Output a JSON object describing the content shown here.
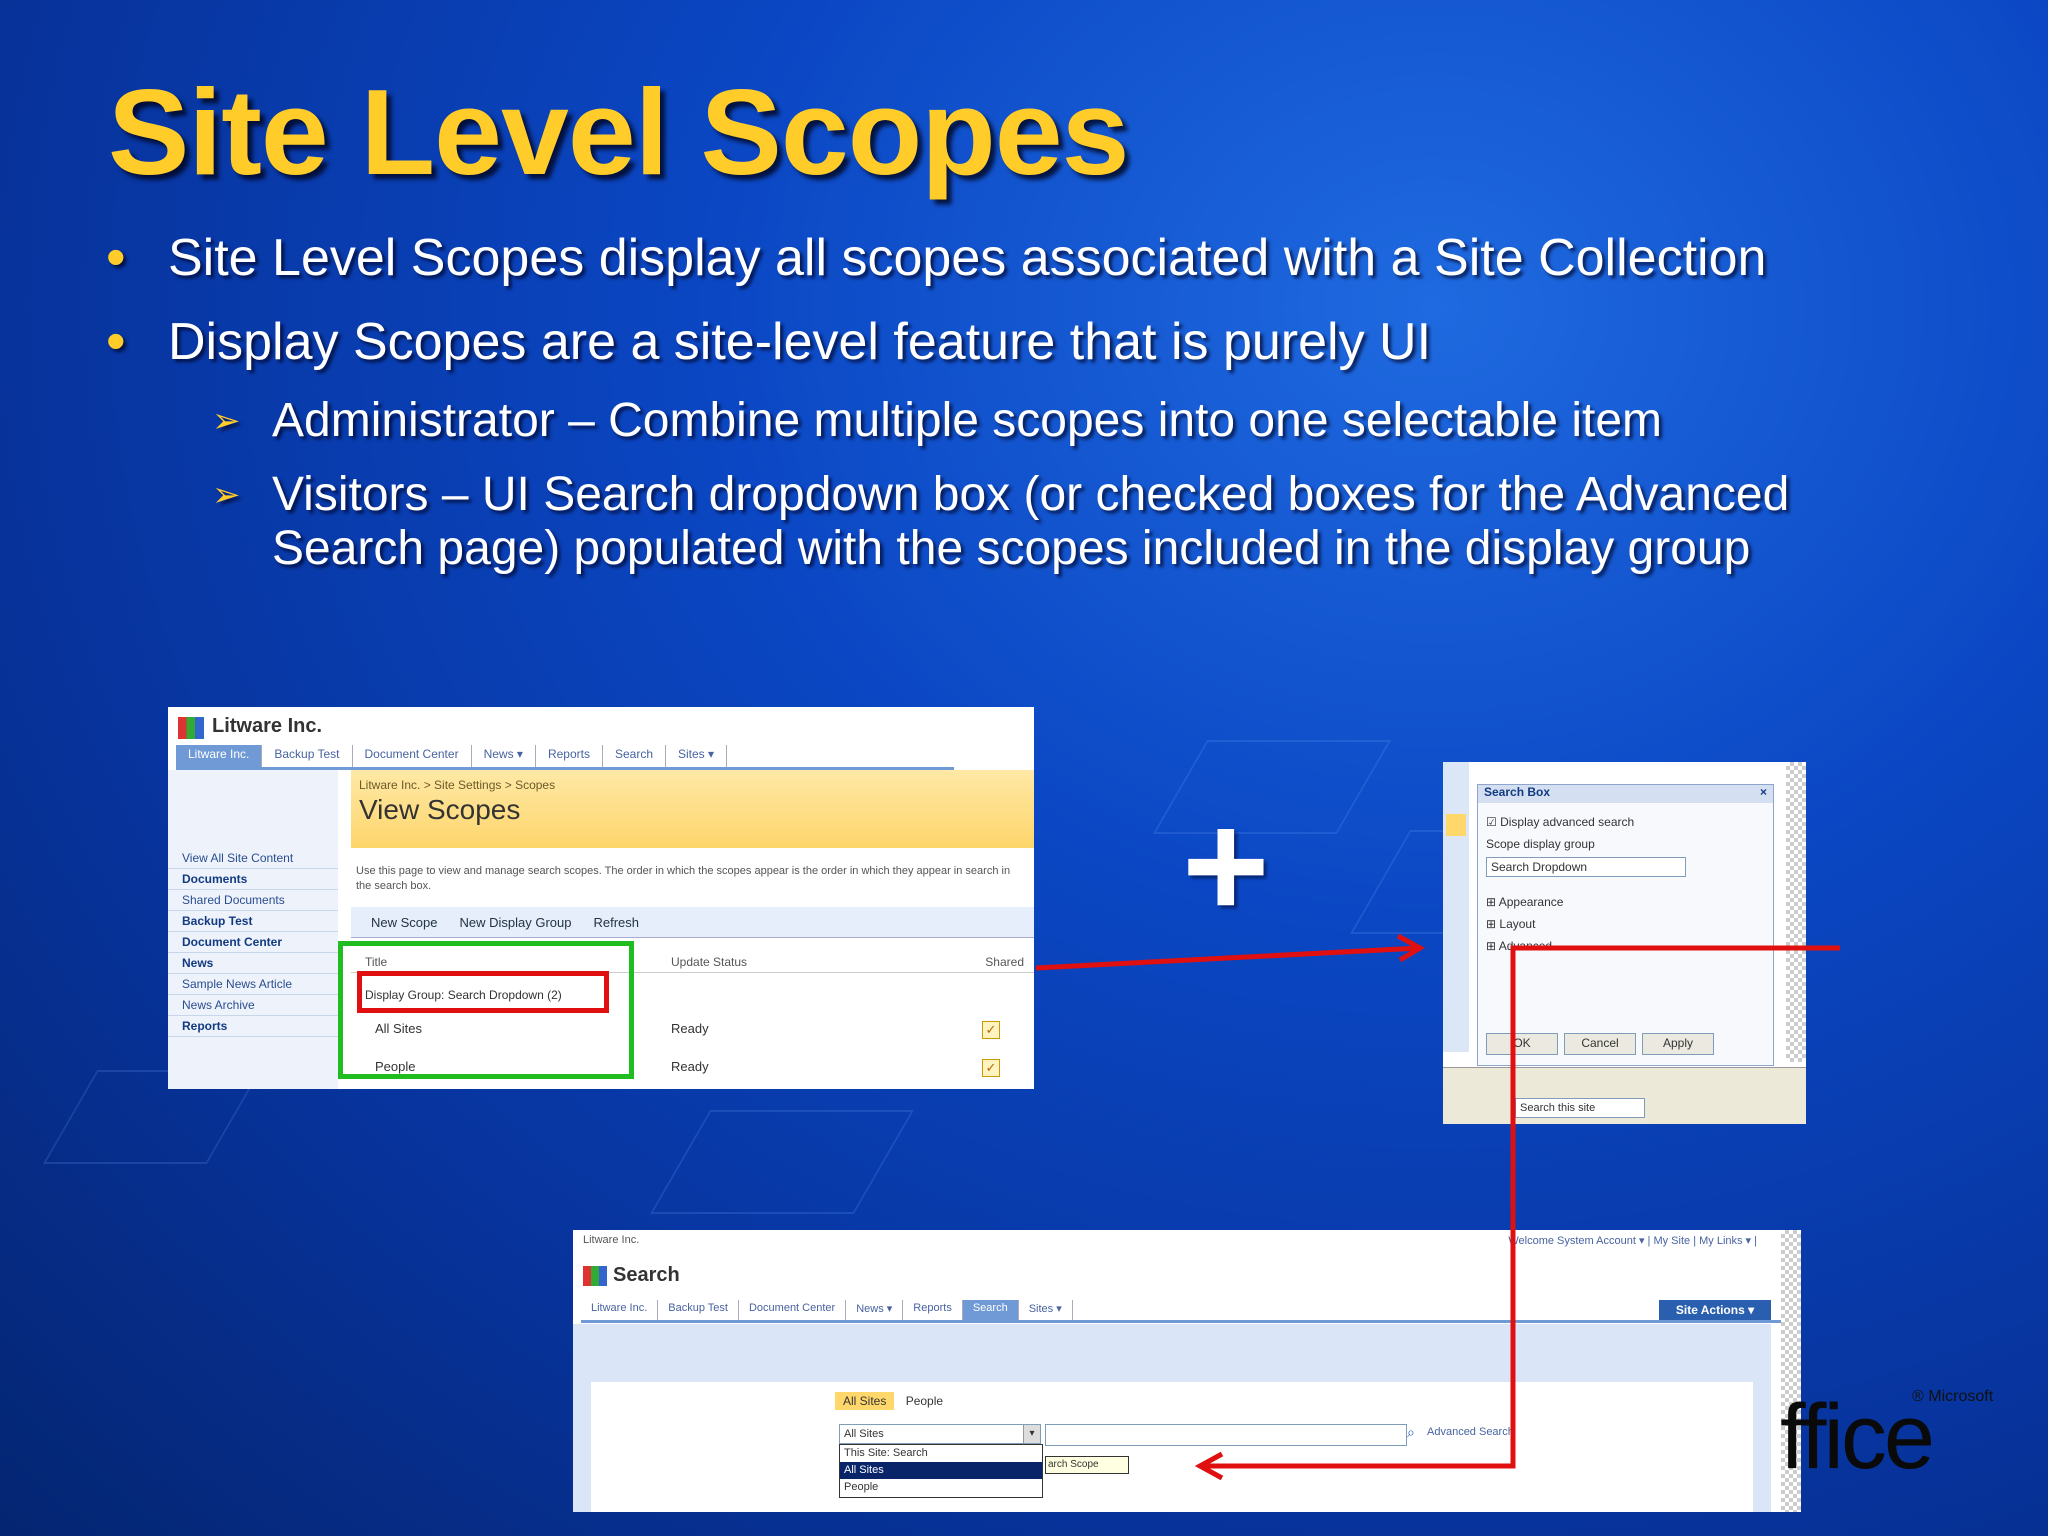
{
  "slide": {
    "title": "Site Level Scopes",
    "bullets": [
      "Site Level Scopes display all scopes associated with a Site Collection",
      "Display Scopes are a site-level feature that is purely UI"
    ],
    "sub_bullets": [
      "Administrator – Combine multiple scopes into one selectable item",
      "Visitors – UI Search dropdown box (or checked boxes for the Advanced Search page) populated with the scopes included in the display group"
    ],
    "plus": "+"
  },
  "scopes_screenshot": {
    "brand": "Litware Inc.",
    "tabs": [
      "Litware Inc.",
      "Backup Test",
      "Document Center",
      "News ▾",
      "Reports",
      "Search",
      "Sites ▾"
    ],
    "breadcrumb": "Litware Inc. > Site Settings > Scopes",
    "page_title": "View Scopes",
    "description": "Use this page to view and manage search scopes. The order in which the scopes appear is the order in which they appear in search in the search box.",
    "left_nav": [
      "View All Site Content",
      "Documents",
      "Shared Documents",
      "Backup Test",
      "Document Center",
      "News",
      "Sample News Article",
      "News Archive",
      "Reports"
    ],
    "toolbar": [
      "New Scope",
      "New Display Group",
      "Refresh"
    ],
    "columns": [
      "Title",
      "Update Status",
      "Shared"
    ],
    "group_row": "Display Group: Search Dropdown (2)",
    "rows": [
      {
        "title": "All Sites",
        "status": "Ready",
        "shared": "✓"
      },
      {
        "title": "People",
        "status": "Ready",
        "shared": "✓"
      }
    ]
  },
  "webpart_screenshot": {
    "panel_title": "Search Box",
    "checkbox_label": "Display advanced search",
    "scope_label": "Scope display group",
    "scope_value": "Search Dropdown",
    "sections": [
      "Appearance",
      "Layout",
      "Advanced"
    ],
    "buttons": [
      "OK",
      "Cancel",
      "Apply"
    ],
    "search_placeholder": "Search this site"
  },
  "search_screenshot": {
    "site_name": "Litware Inc.",
    "welcome": "Welcome System Account ▾ | My Site | My Links ▾ |",
    "brand": "Search",
    "tabs": [
      "Litware Inc.",
      "Backup Test",
      "Document Center",
      "News ▾",
      "Reports",
      "Search",
      "Sites ▾"
    ],
    "site_actions": "Site Actions ▾",
    "scope_tabs": [
      "All Sites",
      "People"
    ],
    "dropdown_value": "All Sites",
    "dropdown_options": [
      "This Site: Search",
      "All Sites",
      "People"
    ],
    "advanced_link": "Advanced Search",
    "tooltip": "arch Scope"
  },
  "colors": {
    "title": "#ffcc2a",
    "highlight_green": "#1fbd1f",
    "highlight_red": "#e01010"
  },
  "logo": {
    "text": "ffice",
    "small": "® Microsoft"
  }
}
